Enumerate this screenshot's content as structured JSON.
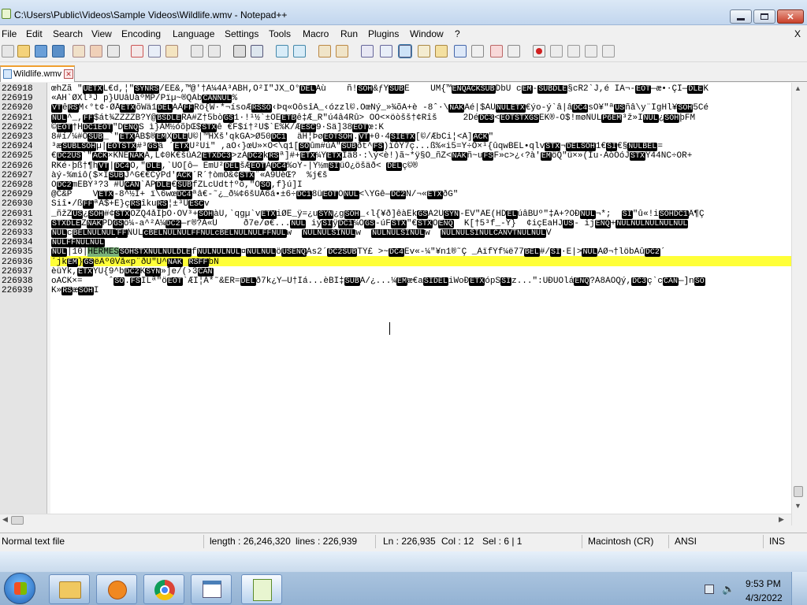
{
  "window": {
    "title": "C:\\Users\\Public\\Videos\\Sample Videos\\Wildlife.wmv - Notepad++"
  },
  "menu": [
    "File",
    "Edit",
    "Search",
    "View",
    "Encoding",
    "Language",
    "Settings",
    "Tools",
    "Macro",
    "Run",
    "Plugins",
    "Window",
    "?"
  ],
  "menu_close": "X",
  "tab": {
    "label": "Wildlife.wmv",
    "close": "✕"
  },
  "lines": [
    {
      "n": "226918",
      "t": "œhZã \"<b>UETX</b>L€d,¦\"<b>SYNRS</b>/ÉÉ&,™@'†À¼4Á³ABH,Ô²I\"JX_Ò°<b>DEL</b>Äù    ñ!<b>SOH</b>&ƒY<b>SUB</b>È    UM{™<b>ENQACKSUB</b>DbÛ c<b>EM</b>-<b>SUBDLE</b>§cR2`J,é IA¬-<b>EOT</b>—æ•·ÇÎ—<b>DLE</b>K"
    },
    {
      "n": "226919",
      "t": "«ÁH`ØXl³J p}UUâUàºMP/Pïµ~®QÁb<b>CANNUL</b>%"
    },
    {
      "n": "226920",
      "t": "<b>VT</b>ê<b>RS</b>M‹°t¢·ØÅ<b>ETX</b>õWä1<b>DEL</b>ÄÅ<b>FF</b>Rö{W·*¬ísoÆ<b>RSSO</b>‹Þq«Òôsî­Â_‹ózzl©.ÒœNý_»¾õÄ+è -8ˆ·\\<b>NAK</b>Âé|$ÀU<b>NULETX</b>€ýo-ý`â|â<b>DC4</b>sÒ¥\"ª<b>US</b>ñâ\\y¨ÎgHl¥<b>SOH</b>5Cé"
    },
    {
      "n": "226921",
      "t": "<b>NUL</b>^_,<b>FF</b>$át¾ZZZZB?Y@<b>BSDLE</b>RA#Z†5bò<b>GS</b>1·!¹½`±OE<b>ETB</b>ê‡Æ_R\"ú4â4Rû> ÒÕ<×öòšš†¢Rîš     2Dé<b>DC3</b><<b>EOTSTXGS</b>ËK®-Ô$!møNUL<b>P6EM</b>³ž»I<b>NUL</b>¿<b>SOH</b>þFM"
    },
    {
      "n": "226922",
      "t": "©<b>EOT</b>†H<b>DC1EOT</b>\"D<b>ENQ</b>Š ì}ÃM½óõþŒ$<b>STX</b>ê €F$í†²U$`È%K/Æ<b>ESC</b>9·Sä]38<b>EOT</b>œ:K"
    },
    {
      "n": "226923",
      "t": "8#í/¼#O<b>SUB</b>_`\"<b>ETX</b>ÀB$®<b>EM</b>X<b>DLE</b>Ü©|™HXš'qkGÀ>Ø50<b>DC1</b>  äH¦Þø<b>EOTSOH</b>.<b>VT</b>+0·4<b>SIETX</b>[©/ÆbCi¦<Â]<b>ACK</b>\""
    },
    {
      "n": "226924",
      "t": "³æ<b>SUBLSOH</b>µ|<b>EOTSTX</b>#³<b>GS</b>ä ´<b>ETX</b>U²Ûi\" ,aÒ‹}œU»×O<\\q1[<b>SO</b>ûm#úÃ\"<b>SUB</b>ðt^<b>FS</b>)ïôY7ç...ß%«i5=Ý÷Ö×¹{ûqw<kÌ¹ïgÀC€<b>BEL</b>•qlv<b>STX</b>¬<b>DELSOH</b>1€<b>SI</b>€§<b>NULBEL</b>="
    },
    {
      "n": "226925",
      "t": "€<b>DC2US</b>`\"<b>ACK</b>×KÑE<b>NAK</b>Á,L¢0K€šüÄ2<b>ETXDC3</b>>zÁ<b>DC2</b>k<b>RS</b>ª]#+<b>ETX</b>¼Ý<b>ETX</b>Iä8·:\\ý<è!)ã~*ÿ§Õ_ñŽ<<b>NAK</b>ñ~u<b>FS</b>F»c>¿‹?à'<b>EM</b>öQ\"ü×»(Íu·ÀòÓóJ<b>STX</b>Ý44ÑC÷ÒR+"
    },
    {
      "n": "226926",
      "t": "RKé·þß†¶h<b>VT</b>|<b>DC4</b>Ö,\"<b>DLE</b>,`ÛO[ô— ÈmÜ²<b>DEL</b>šÆ<b>EOT</b>À<b>DC4</b>%oY-|Ý½m<b>SI</b>üÖ¿öšäð<¯<b>DEL</b>ç©®"
    },
    {
      "n": "226927",
      "t": "àý-%miô($×I<b>SUB</b>J^G€€CýPd'<b>ACK</b>´R´†òmÖ&¢<b>STX</b>¨«A9ÙèŒ?  %j€š"
    },
    {
      "n": "226928",
      "t": "O<b>DC2</b>mÈBÝ³?3 #U<b>CAN</b>`ÅP<b>DLE</b>€<b>SUB</b>fZLcUdt†ºô,\"Ò<b>SO</b>,f}ú]Ï"
    },
    {
      "n": "226929",
      "t": "@C&P    V<b>ETX</b>-8^½Ì+¯ï\\6wœ<b>DC4</b>ªâ€-˜¿_ð¼¢6šÛÀ6á•±6÷<b>DC1</b>8ü<b>EOT</b>Ò<b>NUL</b><\\YGê—<b>DC2</b>Ñ/¬«<b>ETX</b>ðG\""
    },
    {
      "n": "226930",
      "t": "Šiî•/ß<b>FF</b>ªÀ$+È}ç<b>RS</b>îku<b>RS</b>¦±³Ü<b>ESC</b>v"
    },
    {
      "n": "226931",
      "t": "_ñžZ<b>US</b>¿<b>SOH</b>#¢<b>STX</b>ÕZQ4åÌþO·ÓV³+<b>SOH</b>àÙ,`qgµ`v<b>ETX</b>iØÊ_ÿ=¿u<b>SYN</b>¿g<b>SOH</b>_‹l{¥ð]êàÊk<b>GS</b>Ä2Ú<b>SYN</b>-ÊV\"ÂE(HD<b>EL</b>úâBÛº\"‡Â+?ÒÐ<b>NUL</b>¬*;  <b>SI</b>\"û«!i<b>SOHDC1</b>Â¶Ç"
    },
    {
      "n": "226932",
      "t": "<b>STXDLE</b>Z<b>NAK</b>PD<b>GS</b>ö¼-a^²À¼<b>DC2</b>—r®?Á«Û     ð7e/ø€...<b>NUL</b> iý<b>SI</b>ÿ<b>DC1</b>¼Ô<b>GS</b>-úF<b>STX</b>\"€<b>STX</b>Ö<b>ENQ</b>  K[†5³f_-Ý}  ¢içEaHJ<b>US</b>- ij<b>ENQ</b>+<b>NULNULNULNULNUL</b>"
    },
    {
      "n": "226933",
      "t": "<b>NUL</b>c<b>BELNULNUL</b><b>FF</b>NUL<b>cBELNULNULFFNULcBELNULNULFFNUL</b>w  <b>NULNULSINUL</b>w  <b>NULNULSINUL</b>w  <b>NULNULSINULCANVTNULNUL</b>V"
    },
    {
      "n": "226934",
      "t": "<b>NULFFNULNUL</b>"
    },
    {
      "n": "226935",
      "t": "<b>NUL</b>|10|<span id=\"hl-sel\">HERMES</span><b>SOHSTXNULNULDLE</b>f<b>NULNULNUL</b>¤<b>NULNUL</b>ö<b>USENQ</b>Äs2´<b>DC2SUB</b>TÝ£ >~<b>DC4</b>Év«-¼\"¥n1®˜Ç¯_ÃïfÝf¼ë77<b>BEL</b>#/<b>SI</b>·Ë|><b>NUL</b>ÃØ¬†löbÄû<b>DC2</b>´"
    },
    {
      "n": "226936",
      "t": "´jk<b>EM</b>}<b>GS</b>ëÂº0Vå«p¨ðÛ\"Ú^<b>NAK</b> <b>RSFF</b>bN"
    },
    {
      "n": "226937",
      "t": "èüŸk,<b>ETX</b>ÝÚ{9^b<b>DC2</b>K<b>SYN</b>»]e/(›3<b>CAN</b>"
    },
    {
      "n": "226938",
      "t": "o<uÍÏÖcç<b>ACK</b>×=     ˆ<b>SO</b>.<b>FS</b>ÍLª\"ö<b>EOT</b>`ÆÎ¦À*˜&ÉR=<b>DEL</b>ð7k¿Y—Ú†Ìá...èBÍ‡<b>SUB</b>À/¿...¼<b>EM</b>æ€a<b>SIDEL</b>iWoÐ<b>ETX</b>ópS<b>SI</b>z...\":ÙÐÛÓlá<b>ENQ</b>?À8ÀÕQý,<b>DC3</b>ç`c<b>CAN</b>—]n<b>SO</b>"
    },
    {
      "n": "226939",
      "t": "K»<b>RS</b>æ<b>SOH</b>I"
    }
  ],
  "status": {
    "type": "Normal text file",
    "length": "length : 26,246,320",
    "lines": "lines : 226,939",
    "ln": "Ln : 226,935",
    "col": "Col : 12",
    "sel": "Sel : 6 | 1",
    "eol": "Macintosh (CR)",
    "encoding": "ANSI",
    "mode": "INS"
  },
  "clock": {
    "time": "9:53 PM",
    "date": "4/3/2022"
  }
}
